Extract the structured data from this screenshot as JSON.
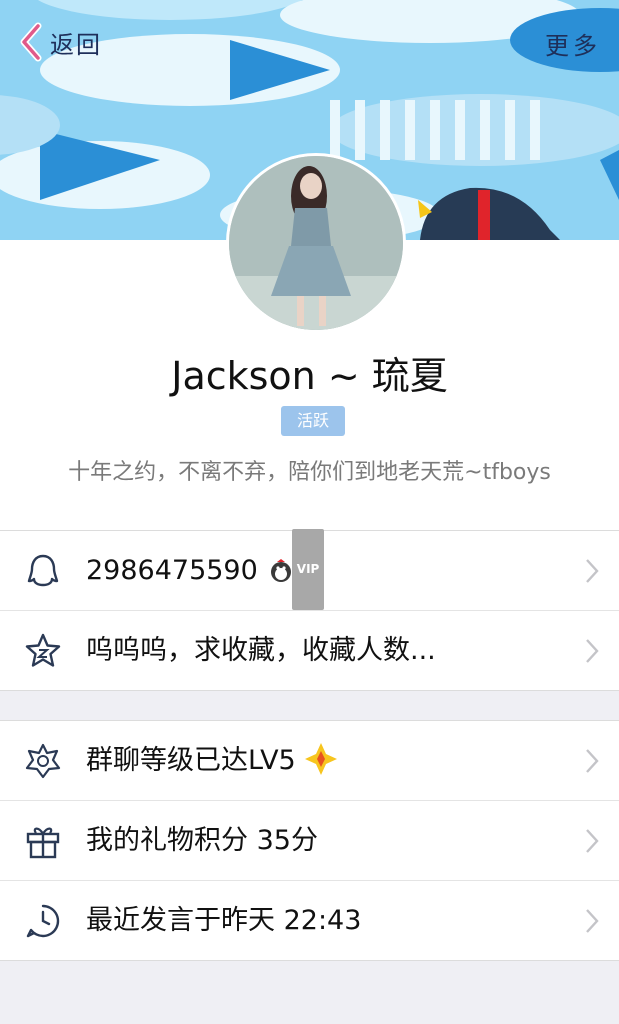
{
  "nav": {
    "back_label": "返回",
    "more_label": "更多"
  },
  "profile": {
    "nickname": "Jackson ~ 琉夏",
    "badge": "活跃",
    "signature": "十年之约，不离不弃，陪你们到地老天荒~tfboys"
  },
  "info_rows": [
    {
      "icon": "qq-penguin-icon",
      "text": "2986475590",
      "vip_label": "VIP"
    },
    {
      "icon": "star-icon",
      "text": "呜呜呜，求收藏，收藏人数..."
    }
  ],
  "detail_rows": [
    {
      "icon": "group-level-star-icon",
      "text": "群聊等级已达LV5"
    },
    {
      "icon": "gift-icon",
      "text": "我的礼物积分 35分"
    },
    {
      "icon": "clock-icon",
      "text": "最近发言于昨天 22:43"
    }
  ],
  "colors": {
    "banner": "#8fd3f3",
    "badge": "#9cc4ec",
    "nav_text": "#1e2f5a",
    "back_chevron": "#e05a8a"
  }
}
